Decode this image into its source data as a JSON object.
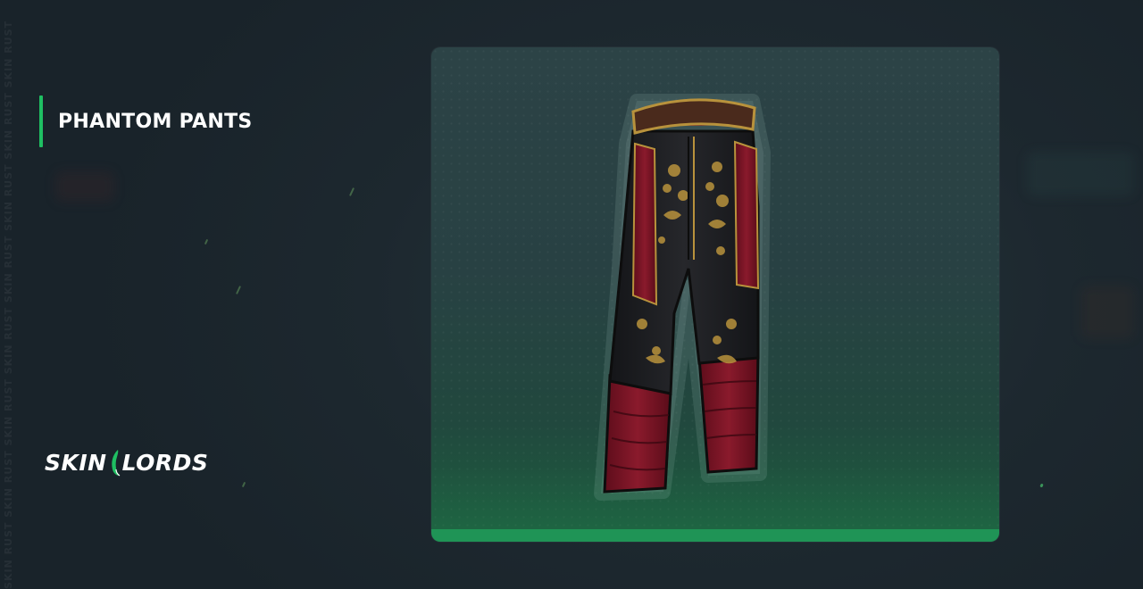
{
  "item": {
    "name": "PHANTOM PANTS",
    "image_icon": "pants-icon"
  },
  "brand": {
    "logo_left": "SKIN",
    "logo_right": "LORDS",
    "watermark": "SKIN RUST SKIN RUST SKIN RUST SKIN RUST SKIN RUST SKIN RUST SKIN RUST SKIN RUST"
  },
  "colors": {
    "accent": "#1fbf62",
    "background": "#1b252c",
    "card_top": "#2c4346",
    "card_bottom": "#1e5a3e",
    "pants_red": "#7d1326",
    "pants_black": "#1b1c1f",
    "pants_gold": "#b8923c"
  }
}
